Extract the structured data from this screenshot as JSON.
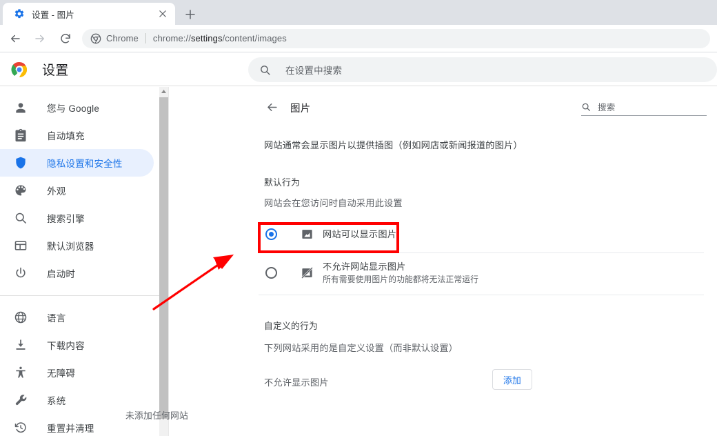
{
  "browser": {
    "tab": {
      "title": "设置 - 图片",
      "favicon_icon": "blue-gear-icon",
      "close_icon": "close-icon"
    },
    "new_tab_icon": "plus-icon",
    "nav": {
      "back_icon": "arrow-left-icon",
      "forward_icon": "arrow-right-icon",
      "reload_icon": "reload-icon"
    },
    "omnibox": {
      "site_icon": "chrome-icon",
      "brand": "Chrome",
      "url_prefix": "chrome://",
      "url_emphasis": "settings",
      "url_suffix": "/content/images"
    }
  },
  "settings_header": {
    "logo_icon": "chrome-logo-icon",
    "title": "设置",
    "search": {
      "icon": "search-icon",
      "placeholder": "在设置中搜索",
      "value": ""
    }
  },
  "sidebar": {
    "groups": [
      {
        "items": [
          {
            "label": "您与 Google",
            "icon": "person-icon",
            "selected": false
          },
          {
            "label": "自动填充",
            "icon": "clipboard-icon",
            "selected": false
          },
          {
            "label": "隐私设置和安全性",
            "icon": "shield-icon",
            "selected": true
          },
          {
            "label": "外观",
            "icon": "palette-icon",
            "selected": false
          },
          {
            "label": "搜索引擎",
            "icon": "search-icon",
            "selected": false
          },
          {
            "label": "默认浏览器",
            "icon": "browser-window-icon",
            "selected": false
          },
          {
            "label": "启动时",
            "icon": "power-icon",
            "selected": false
          }
        ]
      },
      {
        "items": [
          {
            "label": "语言",
            "icon": "globe-icon",
            "selected": false
          },
          {
            "label": "下载内容",
            "icon": "download-icon",
            "selected": false
          },
          {
            "label": "无障碍",
            "icon": "accessibility-icon",
            "selected": false
          },
          {
            "label": "系统",
            "icon": "wrench-icon",
            "selected": false
          },
          {
            "label": "重置并清理",
            "icon": "restore-history-icon",
            "selected": false
          }
        ]
      }
    ],
    "scrollbar": {
      "up_arrow_icon": "scroll-up-arrow-icon"
    }
  },
  "main": {
    "back_icon": "arrow-left-icon",
    "page_title": "图片",
    "search": {
      "icon": "search-icon",
      "placeholder": "搜索",
      "value": ""
    },
    "description": "网站通常会显示图片以提供插图（例如网店或新闻报道的图片）",
    "default_behavior": {
      "title": "默认行为",
      "subtitle": "网站会在您访问时自动采用此设置",
      "options": [
        {
          "label": "网站可以显示图片",
          "sublabel": "",
          "icon": "image-icon",
          "selected": true
        },
        {
          "label": "不允许网站显示图片",
          "sublabel": "所有需要使用图片的功能都将无法正常运行",
          "icon": "image-blocked-icon",
          "selected": false
        }
      ]
    },
    "custom_behavior": {
      "title": "自定义的行为",
      "subtitle": "下列网站采用的是自定义设置（而非默认设置）",
      "list_title": "不允许显示图片",
      "add_button": "添加",
      "empty_text": "未添加任何网站"
    }
  },
  "annotations": {
    "highlight_box_color": "#ff0000",
    "arrow_color": "#ff0000"
  },
  "colors": {
    "accent": "#1a73e8",
    "selected_pill": "#e8f0fe",
    "text_primary": "#202124",
    "text_secondary": "#5f6368",
    "toolbar_bg": "#dee1e6"
  }
}
